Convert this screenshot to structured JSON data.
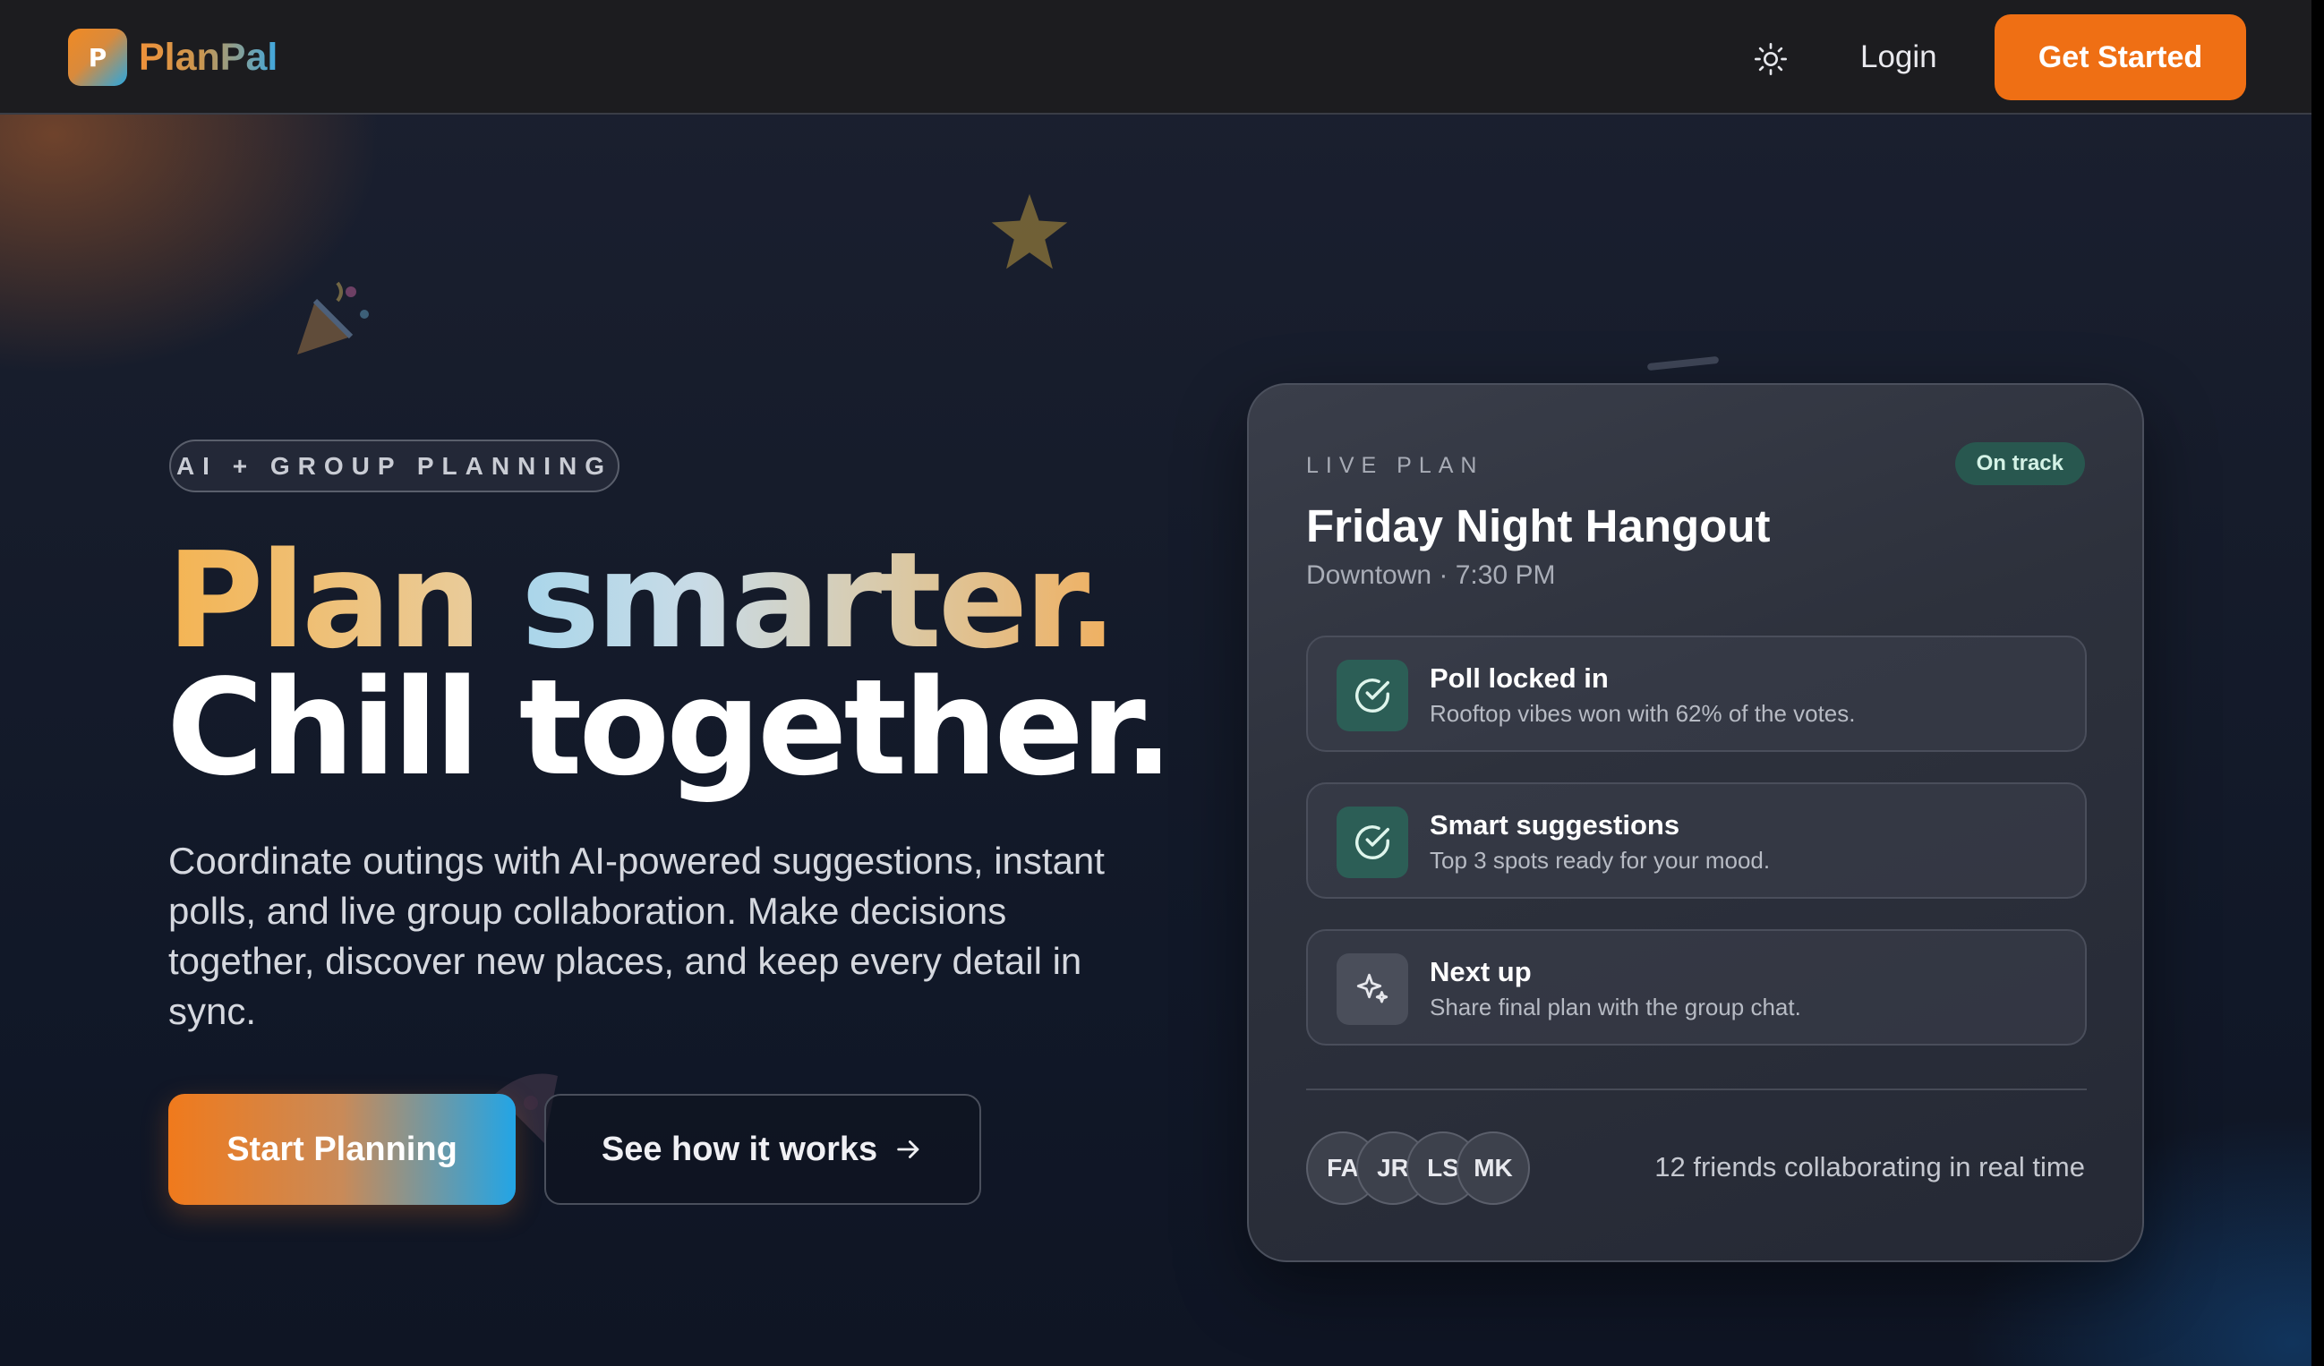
{
  "brand": {
    "logo_letter": "P",
    "name": "PlanPal"
  },
  "nav": {
    "login_label": "Login",
    "cta_label": "Get Started",
    "theme_icon": "sun-icon"
  },
  "hero": {
    "eyebrow": "AI + GROUP PLANNING",
    "headline_word_1": "Plan",
    "headline_word_2": "smarter.",
    "headline_line_2": "Chill together.",
    "description": "Coordinate outings with AI-powered suggestions, instant polls, and live group collaboration. Make decisions together, discover new places, and keep every detail in sync.",
    "primary_cta": "Start Planning",
    "secondary_cta": "See how it works"
  },
  "plan_card": {
    "eyebrow": "LIVE PLAN",
    "status": "On track",
    "title": "Friday Night Hangout",
    "subtitle": "Downtown · 7:30 PM",
    "steps": [
      {
        "title": "Poll locked in",
        "desc": "Rooftop vibes won with 62% of the votes.",
        "icon": "check-circle-icon",
        "state": "done"
      },
      {
        "title": "Smart suggestions",
        "desc": "Top 3 spots ready for your mood.",
        "icon": "check-circle-icon",
        "state": "done"
      },
      {
        "title": "Next up",
        "desc": "Share final plan with the group chat.",
        "icon": "sparkles-icon",
        "state": "pending"
      }
    ],
    "avatars": [
      "FA",
      "JR",
      "LS",
      "MK"
    ],
    "collab_text": "12 friends collaborating in real time"
  },
  "colors": {
    "accent_orange": "#ef6f14",
    "accent_blue": "#22a5e6",
    "status_green_bg": "#28574f",
    "background": "#111828"
  }
}
